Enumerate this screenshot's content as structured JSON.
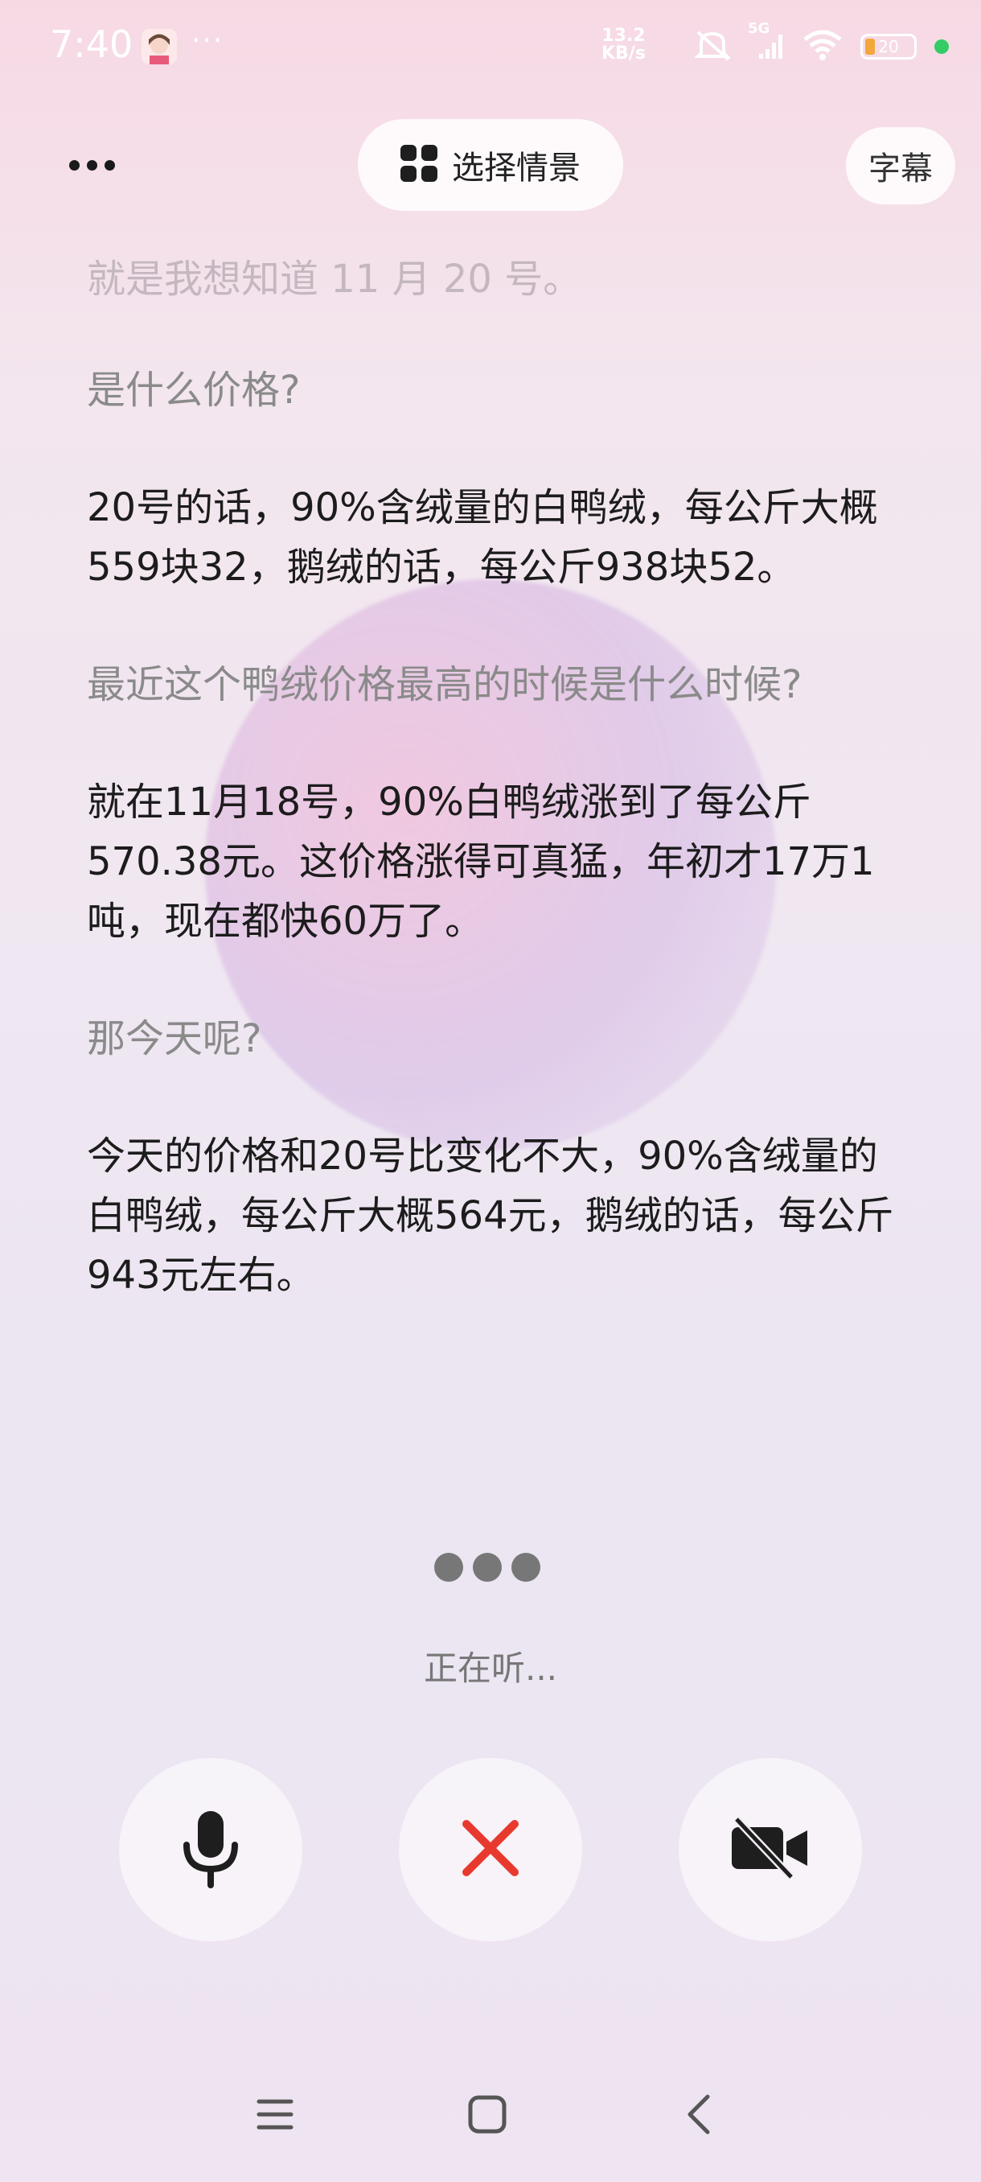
{
  "status_bar": {
    "time": "7:40",
    "more": "···",
    "net_speed_value": "13.2",
    "net_speed_unit": "KB/s",
    "network_type": "5G",
    "battery_level": "20",
    "icons": [
      "avatar-icon",
      "mute-icon",
      "signal-icon",
      "wifi-icon",
      "battery-icon",
      "active-dot"
    ]
  },
  "top_bar": {
    "more_icon": "more-horizontal-icon",
    "scene_button_label": "选择情景",
    "scene_icon": "grid-icon",
    "subtitle_button_label": "字幕"
  },
  "transcript": [
    {
      "role": "user",
      "faded": true,
      "text": "就是我想知道 11 月 20 号。"
    },
    {
      "role": "user",
      "text": "是什么价格?"
    },
    {
      "role": "assistant",
      "text": "20号的话，90%含绒量的白鸭绒，每公斤大概559块32，鹅绒的话，每公斤938块52。"
    },
    {
      "role": "user",
      "text": "最近这个鸭绒价格最高的时候是什么时候?"
    },
    {
      "role": "assistant",
      "text": "就在11月18号，90%白鸭绒涨到了每公斤570.38元。这价格涨得可真猛，年初才17万1吨，现在都快60万了。"
    },
    {
      "role": "user",
      "text": "那今天呢?"
    },
    {
      "role": "assistant",
      "text": "今天的价格和20号比变化不大，90%含绒量的白鸭绒，每公斤大概564元，鹅绒的话，每公斤943元左右。"
    }
  ],
  "listening": {
    "status_text": "正在听..."
  },
  "controls": {
    "mic_icon": "microphone-icon",
    "close_icon": "close-icon",
    "camera_icon": "camera-off-icon",
    "close_color": "#e8392f"
  },
  "nav_bar": {
    "icons": [
      "menu-icon",
      "home-icon",
      "back-icon"
    ]
  }
}
